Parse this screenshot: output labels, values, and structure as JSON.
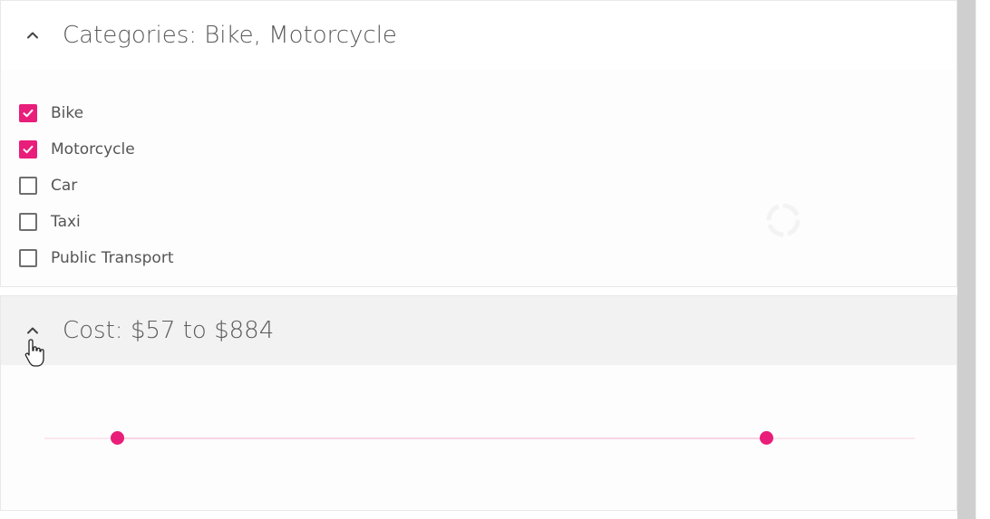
{
  "categories": {
    "title": "Categories: Bike, Motorcycle",
    "options": [
      {
        "label": "Bike",
        "checked": true
      },
      {
        "label": "Motorcycle",
        "checked": true
      },
      {
        "label": "Car",
        "checked": false
      },
      {
        "label": "Taxi",
        "checked": false
      },
      {
        "label": "Public Transport",
        "checked": false
      }
    ]
  },
  "cost": {
    "title": "Cost: $57 to $884",
    "slider": {
      "min_fraction": 0.084,
      "max_fraction": 0.83
    }
  },
  "colors": {
    "accent": "#e91e7a",
    "header_bg": "#f2f2f2",
    "scrollbar": "#cfcfcf"
  },
  "icons": [
    "chevron-up-icon",
    "check-icon",
    "spinner-icon",
    "hand-pointer-icon"
  ]
}
